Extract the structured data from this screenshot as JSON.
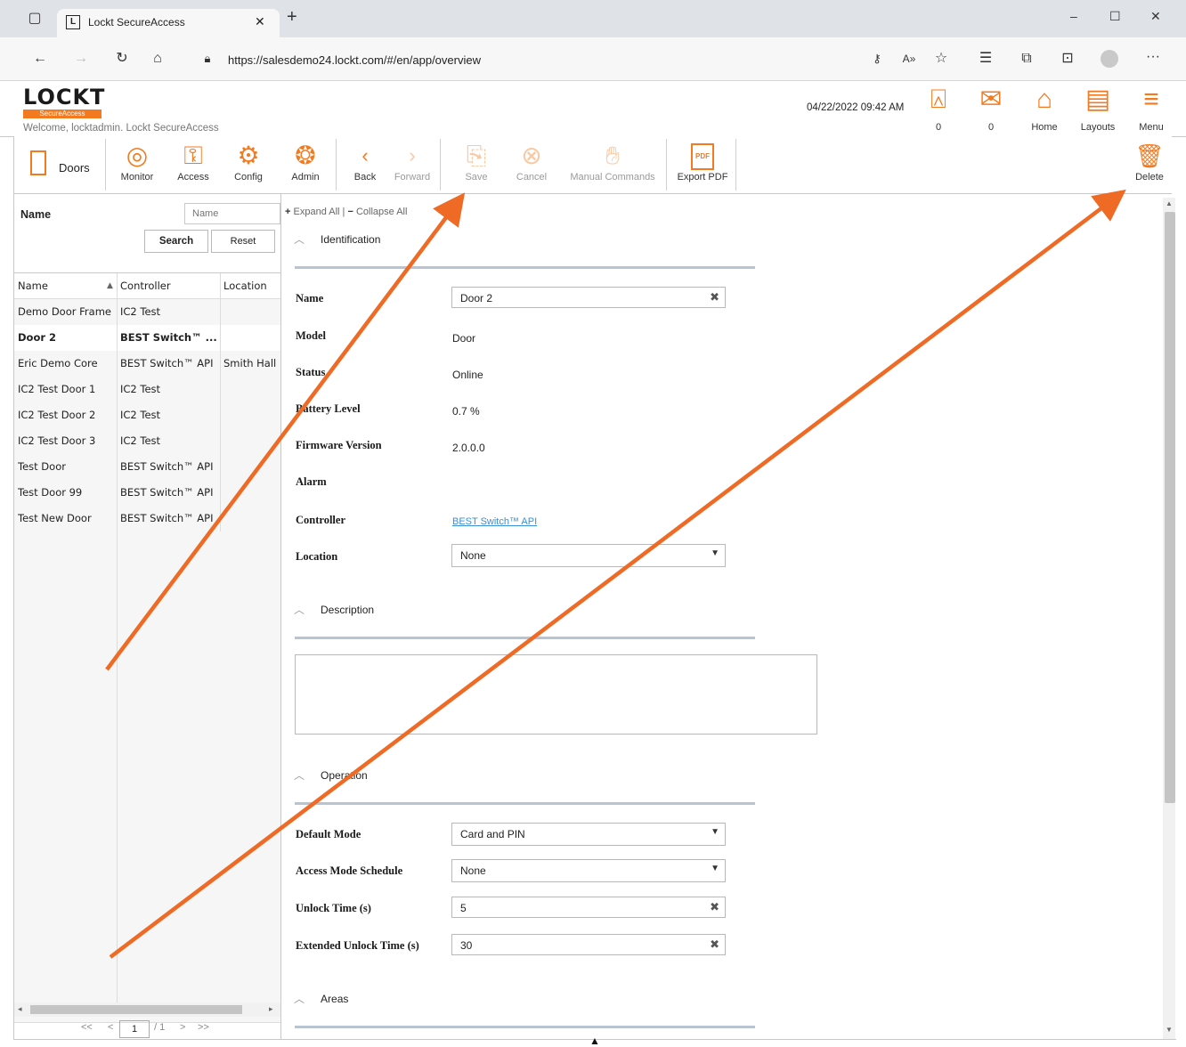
{
  "browser": {
    "tab_title": "Lockt SecureAccess",
    "tab_close": "✕",
    "new_tab": "+",
    "url": "https://salesdemo24.lockt.com/#/en/app/overview",
    "win_min": "–",
    "win_max": "☐",
    "win_close": "✕"
  },
  "app": {
    "logo_text": "LOCKT",
    "logo_sub": "SecureAccess",
    "welcome": "Welcome, locktadmin.  Lockt SecureAccess",
    "datetime": "04/22/2022 09:42 AM",
    "header_items": [
      {
        "label": "0",
        "icon": "alarm-icon"
      },
      {
        "label": "0",
        "icon": "mail-icon"
      },
      {
        "label": "Home",
        "icon": "home-icon"
      },
      {
        "label": "Layouts",
        "icon": "layouts-icon"
      },
      {
        "label": "Menu",
        "icon": "menu-icon"
      }
    ]
  },
  "toolbar": {
    "section_label": "Doors",
    "monitor": "Monitor",
    "access": "Access",
    "config": "Config",
    "admin": "Admin",
    "back": "Back",
    "forward": "Forward",
    "save": "Save",
    "cancel": "Cancel",
    "manual_commands": "Manual Commands",
    "export_pdf": "Export PDF",
    "delete": "Delete"
  },
  "search": {
    "label": "Name",
    "placeholder": "Name",
    "search_button": "Search",
    "reset_button": "Reset"
  },
  "grid": {
    "columns": [
      "Name",
      "Controller",
      "Location"
    ],
    "rows": [
      {
        "name": "Demo Door Frame",
        "controller": "IC2 Test",
        "location": ""
      },
      {
        "name": "Door 2",
        "controller": "BEST Switch™ ...",
        "location": ""
      },
      {
        "name": "Eric Demo Core",
        "controller": "BEST Switch™ API",
        "location": "Smith Hall"
      },
      {
        "name": "IC2 Test Door 1",
        "controller": "IC2 Test",
        "location": ""
      },
      {
        "name": "IC2 Test Door 2",
        "controller": "IC2 Test",
        "location": ""
      },
      {
        "name": "IC2 Test Door 3",
        "controller": "IC2 Test",
        "location": ""
      },
      {
        "name": "Test Door",
        "controller": "BEST Switch™ API",
        "location": ""
      },
      {
        "name": "Test Door 99",
        "controller": "BEST Switch™ API",
        "location": ""
      },
      {
        "name": "Test New Door",
        "controller": "BEST Switch™ API",
        "location": ""
      }
    ],
    "pager": {
      "first": "<<",
      "prev": "<",
      "page": "1",
      "of": "/ 1",
      "next": ">",
      "last": ">>"
    }
  },
  "detail": {
    "expand_all": "Expand All",
    "collapse_all": "Collapse All",
    "sections": {
      "identification": "Identification",
      "description": "Description",
      "operation": "Operation",
      "areas": "Areas"
    },
    "fields": {
      "name_label": "Name",
      "name_value": "Door 2",
      "model_label": "Model",
      "model_value": "Door",
      "status_label": "Status",
      "status_value": "Online",
      "battery_label": "Battery Level",
      "battery_value": "0.7 %",
      "firmware_label": "Firmware Version",
      "firmware_value": "2.0.0.0",
      "alarm_label": "Alarm",
      "controller_label": "Controller",
      "controller_value": "BEST Switch™ API",
      "location_label": "Location",
      "location_value": "None",
      "default_mode_label": "Default Mode",
      "default_mode_value": "Card and PIN",
      "access_schedule_label": "Access Mode Schedule",
      "access_schedule_value": "None",
      "unlock_time_label": "Unlock Time (s)",
      "unlock_time_value": "5",
      "ext_unlock_label": "Extended Unlock Time (s)",
      "ext_unlock_value": "30"
    }
  },
  "colors": {
    "accent": "#f47a20",
    "arrow": "#ee6a25",
    "section_line": "#b9c4d3"
  }
}
